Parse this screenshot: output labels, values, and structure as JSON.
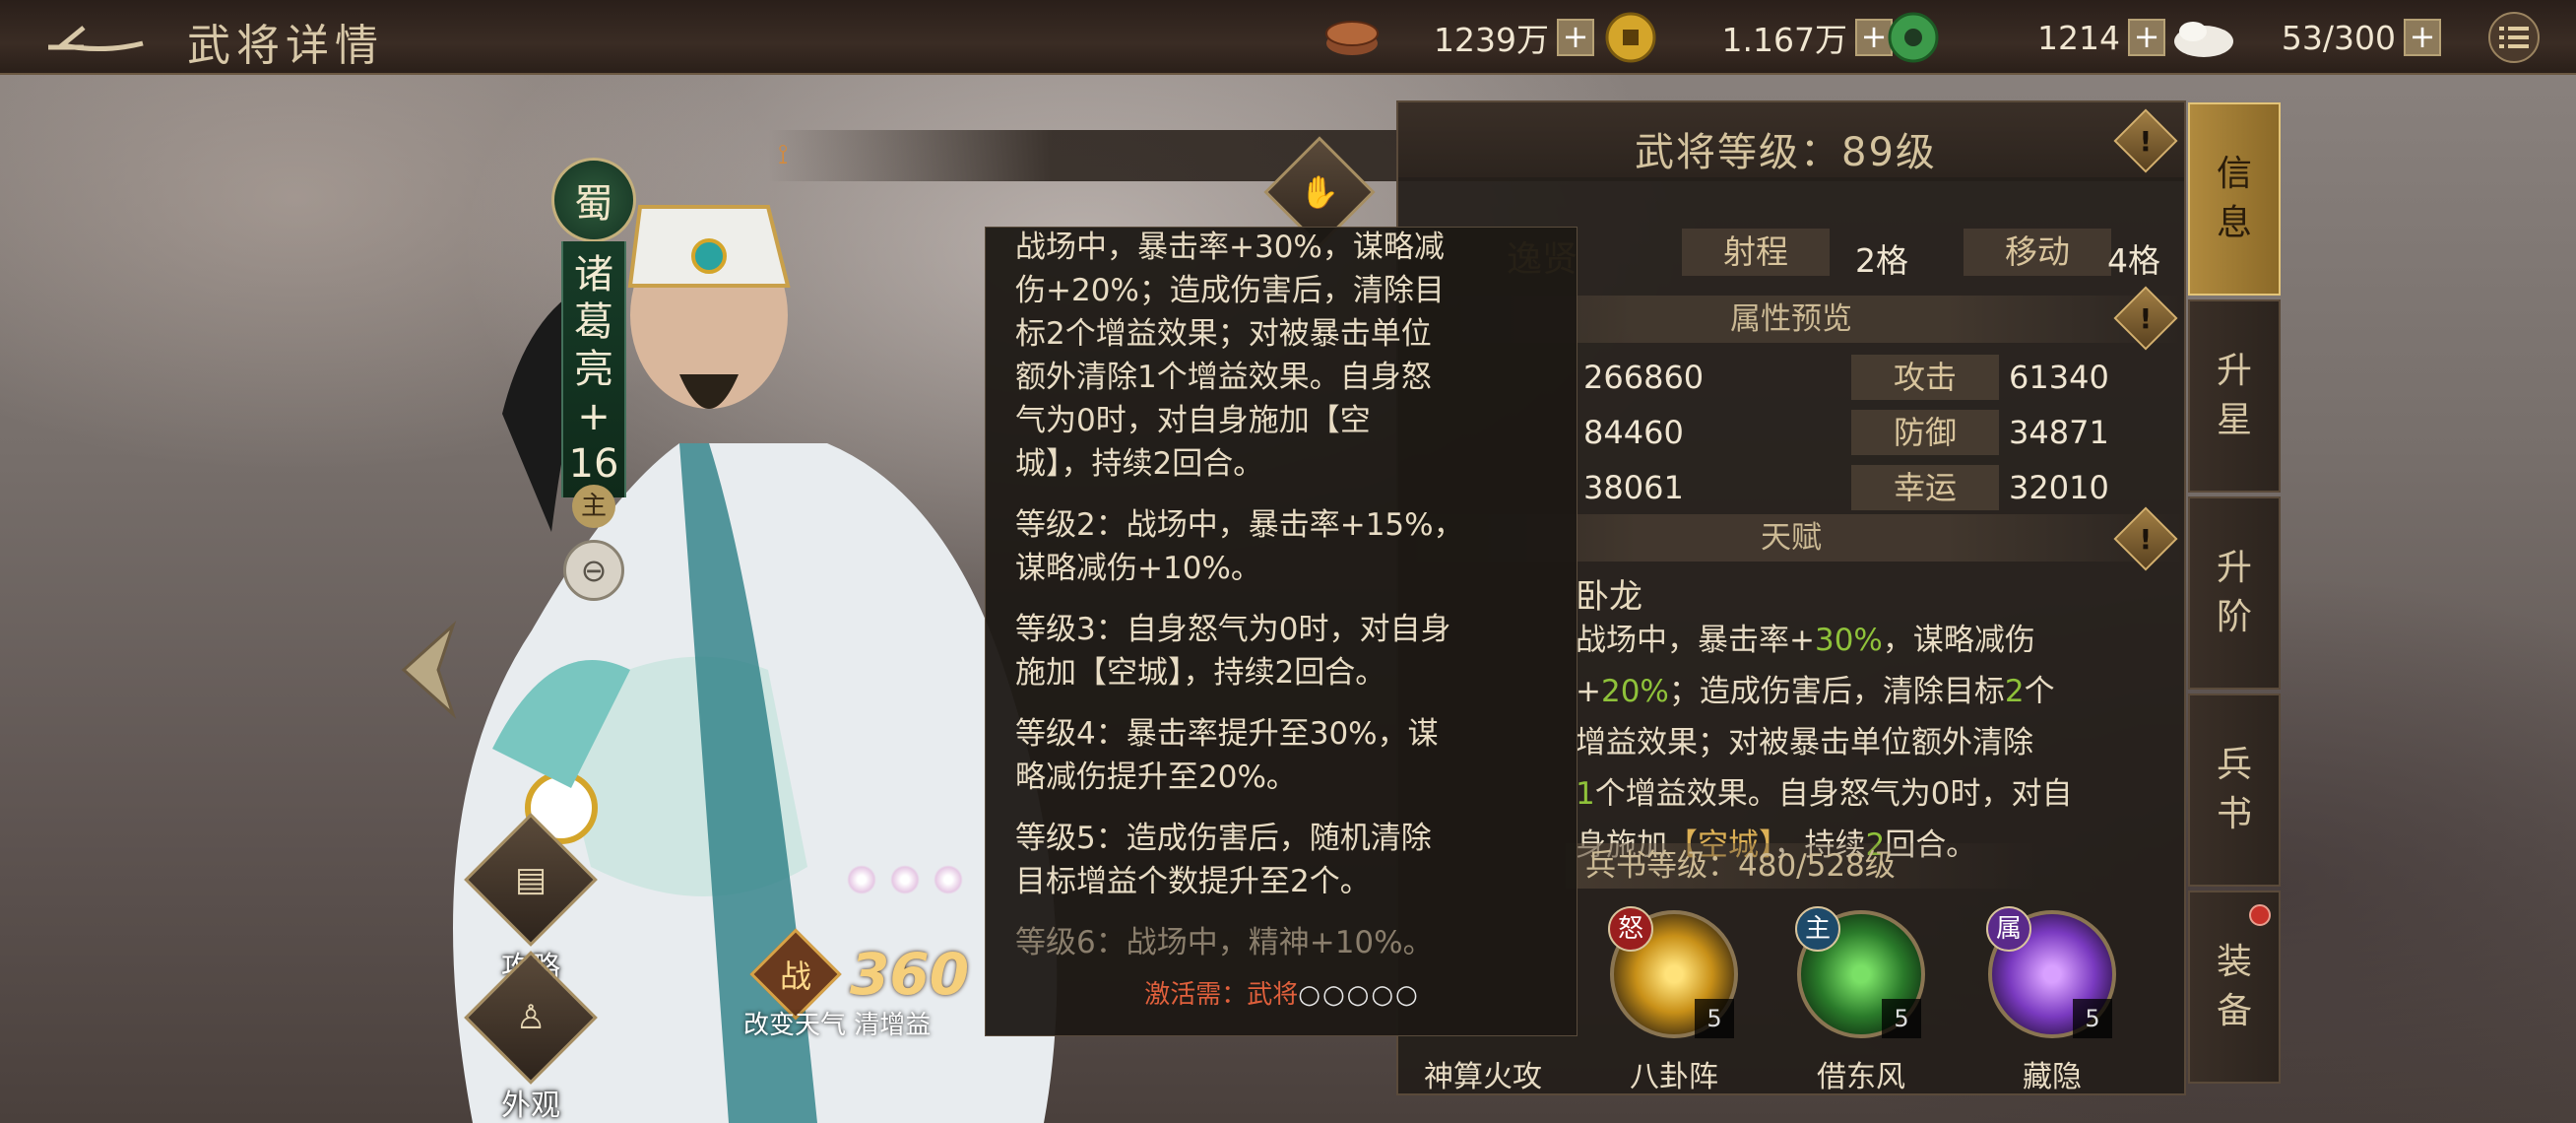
{
  "header": {
    "title": "武将详情",
    "resources": [
      {
        "icon": "copper-coins-icon",
        "value": "1239万"
      },
      {
        "icon": "gold-coin-icon",
        "value": "1.167万"
      },
      {
        "icon": "jade-icon",
        "value": "1214"
      },
      {
        "icon": "stamina-icon",
        "value": "53/300"
      }
    ],
    "plus": "+"
  },
  "hero": {
    "nation": "蜀",
    "name_chars": [
      "诸",
      "葛",
      "亮",
      "+",
      "16"
    ],
    "lord_mark": "主",
    "power_label": "战",
    "power_value": "360",
    "power_desc": "改变天气 清增益"
  },
  "side_buttons": [
    {
      "label": "攻略"
    },
    {
      "label": "外观"
    }
  ],
  "panel": {
    "level": "武将等级：89级",
    "name_partial": "逸贤",
    "range_label": "射程",
    "range_value": "2格",
    "move_label": "移动",
    "move_value": "4格",
    "stats_title": "属性预览",
    "stats": [
      {
        "v1": "266860",
        "k2": "攻击",
        "v2": "61340"
      },
      {
        "v1": "84460",
        "k2": "防御",
        "v2": "34871"
      },
      {
        "v1": "38061",
        "k2": "幸运",
        "v2": "32010"
      }
    ],
    "talent_title": "天赋",
    "talent_name": "卧龙",
    "talent_text": [
      [
        "战场中，暴击率+",
        "30%",
        "，谋略减伤"
      ],
      [
        "+",
        "20%",
        "；造成伤害后，清除目标",
        "2",
        "个"
      ],
      [
        "增益效果；对被暴击单位额外清除"
      ],
      [
        "1",
        "个增益效果。自身怒气为0时，对自"
      ],
      [
        "身施加",
        "【空城】",
        "，持续",
        "2",
        "回合。"
      ]
    ],
    "bingshu_level": "兵书等级：480/528级",
    "skills": [
      {
        "name": "神算火攻",
        "tag": "",
        "level": ""
      },
      {
        "name": "八卦阵",
        "tag": "怒",
        "level": "5"
      },
      {
        "name": "借东风",
        "tag": "主",
        "level": "5"
      },
      {
        "name": "藏隐",
        "tag": "属",
        "level": "5"
      }
    ]
  },
  "tabs": [
    {
      "label": "信息",
      "chars": [
        "信",
        "息"
      ],
      "active": true
    },
    {
      "label": "升星",
      "chars": [
        "升",
        "星"
      ],
      "active": false
    },
    {
      "label": "升阶",
      "chars": [
        "升",
        "阶"
      ],
      "active": false
    },
    {
      "label": "兵书",
      "chars": [
        "兵",
        "书"
      ],
      "active": false
    },
    {
      "label": "装备",
      "chars": [
        "装",
        "备"
      ],
      "active": false
    }
  ],
  "tooltip": {
    "lines": [
      "战场中，暴击率+30%，谋略减",
      "伤+20%；造成伤害后，清除目",
      "标2个增益效果；对被暴击单位",
      "额外清除1个增益效果。自身怒",
      "气为0时，对自身施加【空",
      "城】，持续2回合。",
      "等级2：战场中，暴击率+15%，",
      "谋略减伤+10%。",
      "等级3：自身怒气为0时，对自身",
      "施加【空城】，持续2回合。",
      "等级4：暴击率提升至30%，谋",
      "略减伤提升至20%。",
      "等级5：造成伤害后，随机清除",
      "目标增益个数提升至2个。",
      "等级6：战场中，精神+10%。"
    ],
    "requirement": "激活需：武将",
    "requirement_marks": "○○○○○"
  },
  "colors": {
    "accent_gold": "#b08a3e",
    "highlight_green": "#8fc23a",
    "requirement_red": "#e0603c"
  }
}
